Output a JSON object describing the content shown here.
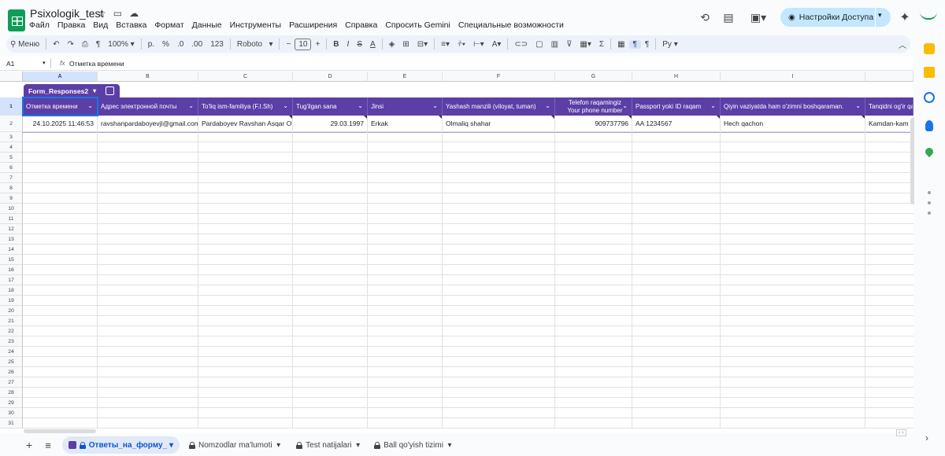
{
  "document": {
    "title": "Psixologik_test"
  },
  "menu": [
    "Файл",
    "Правка",
    "Вид",
    "Вставка",
    "Формат",
    "Данные",
    "Инструменты",
    "Расширения",
    "Справка",
    "Спросить Gemini",
    "Специальные возможности"
  ],
  "share": {
    "label": "Настройки Доступа"
  },
  "toolbar": {
    "menu_label": "Меню",
    "zoom": "100%",
    "currency": "р.",
    "percent": "%",
    "dec_less": ".0",
    "dec_more": ".00",
    "format_123": "123",
    "font": "Roboto",
    "font_size": "10",
    "bold": "B",
    "italic": "I",
    "strike": "S",
    "text_color": "A",
    "script_label": "Ру"
  },
  "formula_bar": {
    "cell_ref": "A1",
    "value": "Отметка времени"
  },
  "columns": [
    "A",
    "B",
    "C",
    "D",
    "E",
    "F",
    "G",
    "H",
    "I"
  ],
  "table": {
    "name": "Form_Responses2",
    "headers": [
      "Отметка времени",
      "Адрес электронной почты",
      "To'liq ism-familiya (F.I.Sh)",
      "Tug'ilgan sana",
      "Jinsi",
      "Yashash manzili (viloyat, tuman)",
      "Telefon raqamingiz\nYour phone number",
      "Passport yoki ID raqam",
      "Qiyin vaziyatda ham o'zimni boshqaraman.",
      "Tanqidni og'ir qabul"
    ],
    "rows": [
      [
        "24.10.2025 11:46:53",
        "ravshanpardaboyevjl@gmail.com",
        "Pardaboyev Ravshan Asqar O'g",
        "29.03.1997",
        "Erkak",
        "Olmaliq shahar",
        "909737796",
        "AA 1234567",
        "Hech qachon",
        "Kamdan-kam"
      ]
    ]
  },
  "row_numbers": [
    "1",
    "2",
    "3",
    "4",
    "5",
    "6",
    "7",
    "8",
    "9",
    "10",
    "11",
    "12",
    "13",
    "14",
    "15",
    "16",
    "17",
    "18",
    "19",
    "20",
    "21",
    "22",
    "23",
    "24",
    "25",
    "26",
    "27",
    "28",
    "29",
    "30",
    "31"
  ],
  "sheets": [
    {
      "label": "Ответы_на_форму_",
      "active": true,
      "locked": true
    },
    {
      "label": "Nomzodlar ma'lumoti",
      "active": false,
      "locked": true
    },
    {
      "label": "Test natijalari",
      "active": false,
      "locked": true
    },
    {
      "label": "Ball qo'yish tizimi",
      "active": false,
      "locked": true
    }
  ],
  "colors": {
    "accent": "#5b3ea6",
    "select": "#1a73e8",
    "share_bg": "#c2e7ff",
    "logo": "#0f9d58"
  }
}
